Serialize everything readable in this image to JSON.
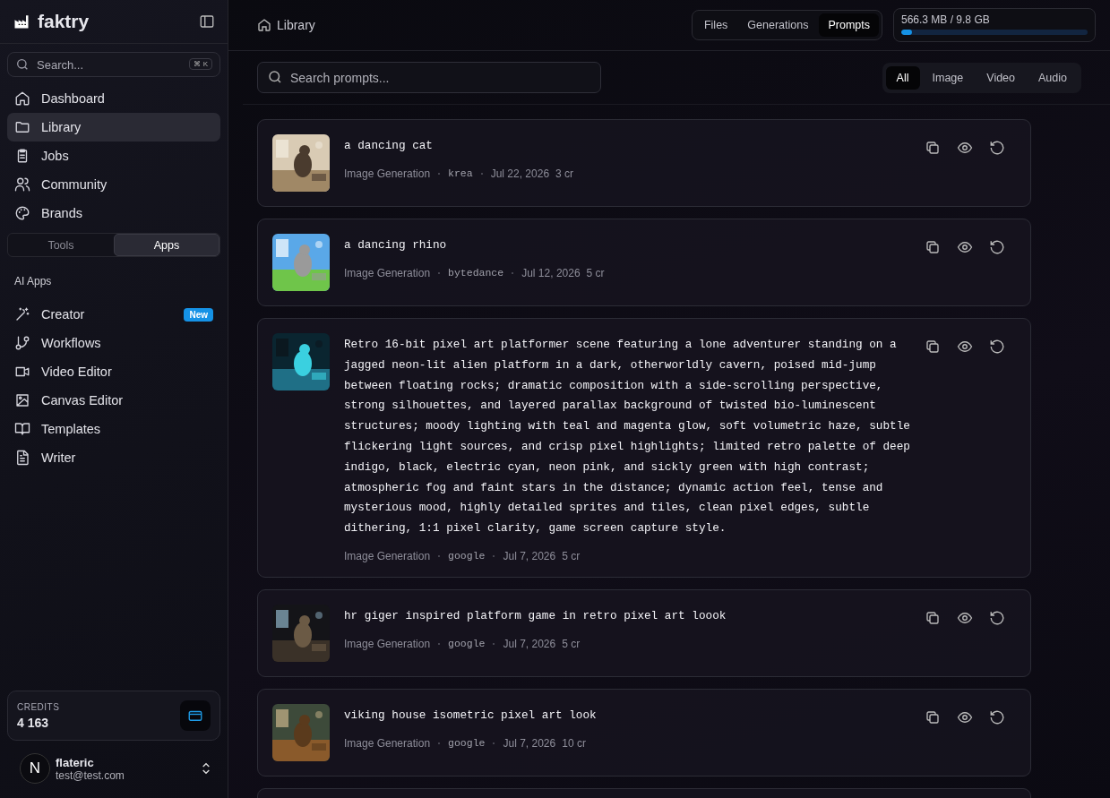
{
  "sidebar": {
    "brand": "faktry",
    "search": {
      "placeholder": "Search...",
      "shortcut": "⌘ K"
    },
    "nav": [
      {
        "label": "Dashboard",
        "selected": false
      },
      {
        "label": "Library",
        "selected": true
      },
      {
        "label": "Jobs",
        "selected": false
      },
      {
        "label": "Community",
        "selected": false
      },
      {
        "label": "Brands",
        "selected": false
      }
    ],
    "switch": [
      {
        "label": "Tools",
        "selected": false
      },
      {
        "label": "Apps",
        "selected": true
      }
    ],
    "section_title": "AI Apps",
    "apps": [
      {
        "label": "Creator",
        "badge": "New"
      },
      {
        "label": "Workflows"
      },
      {
        "label": "Video Editor"
      },
      {
        "label": "Canvas Editor"
      },
      {
        "label": "Templates"
      },
      {
        "label": "Writer"
      }
    ],
    "credits": {
      "label": "CREDITS",
      "value": "4 163"
    },
    "user": {
      "initial": "N",
      "name": "flateric",
      "email": "test@test.com"
    }
  },
  "header": {
    "breadcrumb": "Library",
    "tabs": [
      {
        "label": "Files",
        "selected": false
      },
      {
        "label": "Generations",
        "selected": false
      },
      {
        "label": "Prompts",
        "selected": true
      }
    ],
    "storage": {
      "reading": "566.3 MB / 9.8 GB",
      "level": 0.057
    }
  },
  "toolbar": {
    "search": {
      "placeholder": "Search prompts..."
    },
    "filters": [
      {
        "label": "All",
        "selected": true
      },
      {
        "label": "Image",
        "selected": false
      },
      {
        "label": "Video",
        "selected": false
      },
      {
        "label": "Audio",
        "selected": false
      }
    ]
  },
  "prompts": [
    {
      "text": "a dancing cat",
      "type": "Image Generation",
      "model": "krea",
      "date": "Jul 22, 2026",
      "cost": "3 cr"
    },
    {
      "text": "a dancing rhino",
      "type": "Image Generation",
      "model": "bytedance",
      "date": "Jul 12, 2026",
      "cost": "5 cr"
    },
    {
      "text": "Retro 16-bit pixel art platformer scene featuring a lone adventurer standing on a jagged neon-lit alien platform in a dark, otherworldly cavern, poised mid-jump between floating rocks; dramatic composition with a side-scrolling perspective, strong silhouettes, and layered parallax background of twisted bio-luminescent structures; moody lighting with teal and magenta glow, soft volumetric haze, subtle flickering light sources, and crisp pixel highlights; limited retro palette of deep indigo, black, electric cyan, neon pink, and sickly green with high contrast; atmospheric fog and faint stars in the distance; dynamic action feel, tense and mysterious mood, highly detailed sprites and tiles, clean pixel edges, subtle dithering, 1:1 pixel clarity, game screen capture style.",
      "type": "Image Generation",
      "model": "google",
      "date": "Jul 7, 2026",
      "cost": "5 cr"
    },
    {
      "text": "hr giger inspired platform game in retro pixel art loook",
      "type": "Image Generation",
      "model": "google",
      "date": "Jul 7, 2026",
      "cost": "5 cr"
    },
    {
      "text": "viking house isometric pixel art look",
      "type": "Image Generation",
      "model": "google",
      "date": "Jul 7, 2026",
      "cost": "10 cr"
    }
  ]
}
